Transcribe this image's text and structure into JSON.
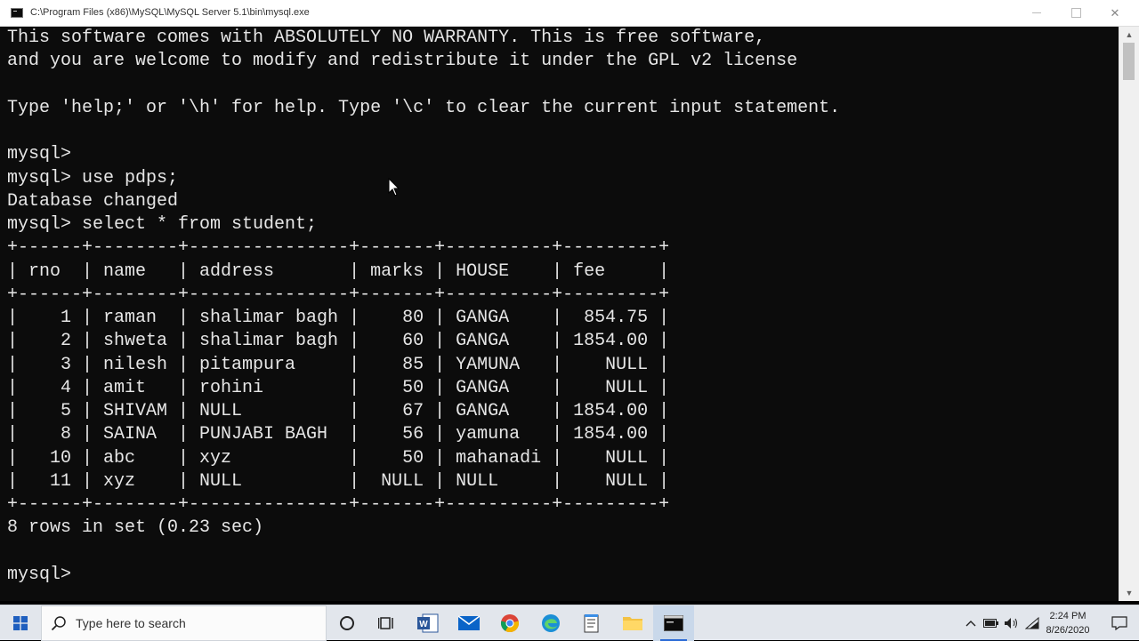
{
  "window": {
    "title": "C:\\Program Files (x86)\\MySQL\\MySQL Server 5.1\\bin\\mysql.exe",
    "icon": "console-window-icon",
    "minimize": "minimize",
    "maximize": "maximize",
    "close": "✕"
  },
  "console": {
    "lines": [
      "This software comes with ABSOLUTELY NO WARRANTY. This is free software,",
      "and you are welcome to modify and redistribute it under the GPL v2 license",
      "",
      "Type 'help;' or '\\h' for help. Type '\\c' to clear the current input statement.",
      "",
      "mysql>",
      "mysql> use pdps;",
      "Database changed",
      "mysql> select * from student;"
    ],
    "table_border": "+------+--------+---------------+-------+----------+---------+",
    "table_header": "| rno  | name   | address       | marks | HOUSE    | fee     |",
    "table_rows": [
      "|    1 | raman  | shalimar bagh |    80 | GANGA    |  854.75 |",
      "|    2 | shweta | shalimar bagh |    60 | GANGA    | 1854.00 |",
      "|    3 | nilesh | pitampura     |    85 | YAMUNA   |    NULL |",
      "|    4 | amit   | rohini        |    50 | GANGA    |    NULL |",
      "|    5 | SHIVAM | NULL          |    67 | GANGA    | 1854.00 |",
      "|    8 | SAINA  | PUNJABI BAGH  |    56 | yamuna   | 1854.00 |",
      "|   10 | abc    | xyz           |    50 | mahanadi |    NULL |",
      "|   11 | xyz    | NULL          |  NULL | NULL     |    NULL |"
    ],
    "summary": "8 rows in set (0.23 sec)",
    "blank": "",
    "prompt": "mysql>"
  },
  "taskbar": {
    "search_placeholder": "Type here to search",
    "time": "2:24 PM",
    "date": "8/26/2020",
    "icons": [
      "windows-start-icon",
      "search-icon",
      "cortana-icon",
      "task-view-icon",
      "word-icon",
      "mail-icon",
      "chrome-icon",
      "edge-icon",
      "notepad-icon",
      "file-explorer-icon",
      "console-app-icon"
    ],
    "tray": [
      "chevron-up-icon",
      "battery-icon",
      "volume-icon",
      "wifi-icon",
      "notification-icon"
    ]
  },
  "colors": {
    "console_bg": "#0c0c0c",
    "console_text": "#e6e6e6",
    "taskbar_bg": "#e2e6ec",
    "accent": "#2b6bd6"
  }
}
